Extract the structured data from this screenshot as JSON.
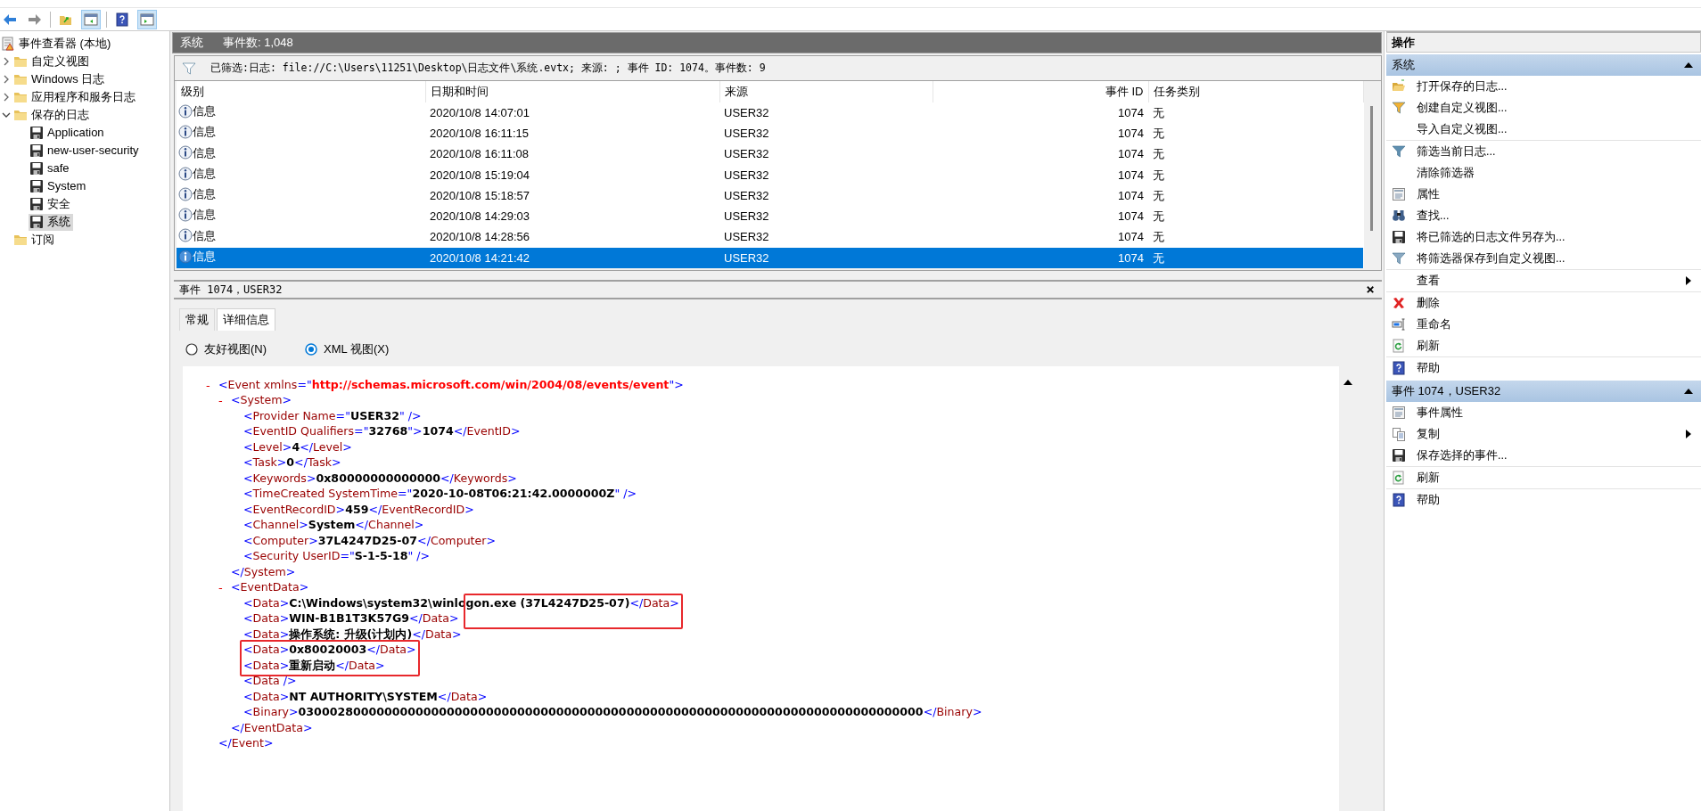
{
  "toolbar": [
    {
      "kind": "back",
      "pressed": false
    },
    {
      "kind": "forward",
      "pressed": false
    },
    {
      "kind": "up",
      "pressed": false
    },
    {
      "kind": "tree-pane",
      "pressed": true
    },
    {
      "kind": "help",
      "pressed": false
    },
    {
      "kind": "action-pane",
      "pressed": true
    }
  ],
  "tree": [
    {
      "label": "事件查看器 (本地)",
      "kind": "root",
      "selected": false,
      "children": [
        {
          "label": "自定义视图",
          "kind": "folder",
          "expanded": false,
          "selected": false
        },
        {
          "label": "Windows 日志",
          "kind": "folder",
          "expanded": false,
          "selected": false
        },
        {
          "label": "应用程序和服务日志",
          "kind": "folder",
          "expanded": false,
          "selected": false
        },
        {
          "label": "保存的日志",
          "kind": "folder",
          "expanded": true,
          "selected": false,
          "children": [
            {
              "label": "Application",
              "kind": "log",
              "selected": false
            },
            {
              "label": "new-user-security",
              "kind": "log",
              "selected": false
            },
            {
              "label": "safe",
              "kind": "log",
              "selected": false
            },
            {
              "label": "System",
              "kind": "log",
              "selected": false
            },
            {
              "label": "安全",
              "kind": "log",
              "selected": false
            },
            {
              "label": "系统",
              "kind": "log",
              "selected": true
            }
          ]
        },
        {
          "label": "订阅",
          "kind": "folder",
          "selected": false
        }
      ]
    }
  ],
  "log_header": {
    "title": "系统",
    "count": "事件数: 1,048"
  },
  "filter": {
    "text": "已筛选:日志: file://C:\\Users\\11251\\Desktop\\日志文件\\系统.evtx; 来源: ; 事件 ID: 1074。事件数: 9"
  },
  "table": {
    "columns": [
      {
        "label": "级别",
        "kind": "level"
      },
      {
        "label": "日期和时间",
        "kind": "text"
      },
      {
        "label": "来源",
        "kind": "text"
      },
      {
        "label": "事件 ID",
        "kind": "number"
      },
      {
        "label": "任务类别",
        "kind": "text"
      }
    ],
    "rows": [
      {
        "cells": [
          "信息",
          "2020/10/8 14:07:01",
          "USER32",
          "1074",
          "无"
        ],
        "selected": false
      },
      {
        "cells": [
          "信息",
          "2020/10/8 16:11:15",
          "USER32",
          "1074",
          "无"
        ],
        "selected": false
      },
      {
        "cells": [
          "信息",
          "2020/10/8 16:11:08",
          "USER32",
          "1074",
          "无"
        ],
        "selected": false
      },
      {
        "cells": [
          "信息",
          "2020/10/8 15:19:04",
          "USER32",
          "1074",
          "无"
        ],
        "selected": false
      },
      {
        "cells": [
          "信息",
          "2020/10/8 15:18:57",
          "USER32",
          "1074",
          "无"
        ],
        "selected": false
      },
      {
        "cells": [
          "信息",
          "2020/10/8 14:29:03",
          "USER32",
          "1074",
          "无"
        ],
        "selected": false
      },
      {
        "cells": [
          "信息",
          "2020/10/8 14:28:56",
          "USER32",
          "1074",
          "无"
        ],
        "selected": false
      },
      {
        "cells": [
          "信息",
          "2020/10/8 14:21:42",
          "USER32",
          "1074",
          "无"
        ],
        "selected": true
      }
    ]
  },
  "detail": {
    "title": "事件 1074，USER32",
    "close": "×",
    "tabs": [
      {
        "label": "常规",
        "selected": false
      },
      {
        "label": "详细信息",
        "selected": true
      }
    ],
    "views": [
      {
        "label": "友好视图(N)",
        "selected": false
      },
      {
        "label": "XML 视图(X)",
        "selected": true
      }
    ],
    "xml": [
      {
        "toggle": "-",
        "segments": [
          {
            "kind": "punct",
            "text": "<"
          },
          {
            "kind": "name",
            "text": "Event xmlns"
          },
          {
            "kind": "punct",
            "text": "=\""
          },
          {
            "kind": "namespace",
            "text": "http://schemas.microsoft.com/win/2004/08/events/event"
          },
          {
            "kind": "punct",
            "text": "\">"
          }
        ],
        "children": [
          {
            "toggle": "-",
            "segments": [
              {
                "kind": "punct",
                "text": "<"
              },
              {
                "kind": "name",
                "text": "System"
              },
              {
                "kind": "punct",
                "text": ">"
              }
            ],
            "children": [
              {
                "segments": [
                  {
                    "kind": "punct",
                    "text": "<"
                  },
                  {
                    "kind": "name",
                    "text": "Provider Name"
                  },
                  {
                    "kind": "punct",
                    "text": "=\""
                  },
                  {
                    "kind": "value",
                    "text": "USER32"
                  },
                  {
                    "kind": "punct",
                    "text": "\" />"
                  }
                ]
              },
              {
                "segments": [
                  {
                    "kind": "punct",
                    "text": "<"
                  },
                  {
                    "kind": "name",
                    "text": "EventID Qualifiers"
                  },
                  {
                    "kind": "punct",
                    "text": "=\""
                  },
                  {
                    "kind": "value",
                    "text": "32768"
                  },
                  {
                    "kind": "punct",
                    "text": "\">"
                  },
                  {
                    "kind": "value",
                    "text": "1074"
                  },
                  {
                    "kind": "punct",
                    "text": "</"
                  },
                  {
                    "kind": "name",
                    "text": "EventID"
                  },
                  {
                    "kind": "punct",
                    "text": ">"
                  }
                ]
              },
              {
                "segments": [
                  {
                    "kind": "punct",
                    "text": "<"
                  },
                  {
                    "kind": "name",
                    "text": "Level"
                  },
                  {
                    "kind": "punct",
                    "text": ">"
                  },
                  {
                    "kind": "value",
                    "text": "4"
                  },
                  {
                    "kind": "punct",
                    "text": "</"
                  },
                  {
                    "kind": "name",
                    "text": "Level"
                  },
                  {
                    "kind": "punct",
                    "text": ">"
                  }
                ]
              },
              {
                "segments": [
                  {
                    "kind": "punct",
                    "text": "<"
                  },
                  {
                    "kind": "name",
                    "text": "Task"
                  },
                  {
                    "kind": "punct",
                    "text": ">"
                  },
                  {
                    "kind": "value",
                    "text": "0"
                  },
                  {
                    "kind": "punct",
                    "text": "</"
                  },
                  {
                    "kind": "name",
                    "text": "Task"
                  },
                  {
                    "kind": "punct",
                    "text": ">"
                  }
                ]
              },
              {
                "segments": [
                  {
                    "kind": "punct",
                    "text": "<"
                  },
                  {
                    "kind": "name",
                    "text": "Keywords"
                  },
                  {
                    "kind": "punct",
                    "text": ">"
                  },
                  {
                    "kind": "value",
                    "text": "0x80000000000000"
                  },
                  {
                    "kind": "punct",
                    "text": "</"
                  },
                  {
                    "kind": "name",
                    "text": "Keywords"
                  },
                  {
                    "kind": "punct",
                    "text": ">"
                  }
                ]
              },
              {
                "segments": [
                  {
                    "kind": "punct",
                    "text": "<"
                  },
                  {
                    "kind": "name",
                    "text": "TimeCreated SystemTime"
                  },
                  {
                    "kind": "punct",
                    "text": "=\""
                  },
                  {
                    "kind": "value",
                    "text": "2020-10-08T06:21:42.0000000Z"
                  },
                  {
                    "kind": "punct",
                    "text": "\" />"
                  }
                ]
              },
              {
                "segments": [
                  {
                    "kind": "punct",
                    "text": "<"
                  },
                  {
                    "kind": "name",
                    "text": "EventRecordID"
                  },
                  {
                    "kind": "punct",
                    "text": ">"
                  },
                  {
                    "kind": "value",
                    "text": "459"
                  },
                  {
                    "kind": "punct",
                    "text": "</"
                  },
                  {
                    "kind": "name",
                    "text": "EventRecordID"
                  },
                  {
                    "kind": "punct",
                    "text": ">"
                  }
                ]
              },
              {
                "segments": [
                  {
                    "kind": "punct",
                    "text": "<"
                  },
                  {
                    "kind": "name",
                    "text": "Channel"
                  },
                  {
                    "kind": "punct",
                    "text": ">"
                  },
                  {
                    "kind": "value",
                    "text": "System"
                  },
                  {
                    "kind": "punct",
                    "text": "</"
                  },
                  {
                    "kind": "name",
                    "text": "Channel"
                  },
                  {
                    "kind": "punct",
                    "text": ">"
                  }
                ]
              },
              {
                "segments": [
                  {
                    "kind": "punct",
                    "text": "<"
                  },
                  {
                    "kind": "name",
                    "text": "Computer"
                  },
                  {
                    "kind": "punct",
                    "text": ">"
                  },
                  {
                    "kind": "value",
                    "text": "37L4247D25-07"
                  },
                  {
                    "kind": "punct",
                    "text": "</"
                  },
                  {
                    "kind": "name",
                    "text": "Computer"
                  },
                  {
                    "kind": "punct",
                    "text": ">"
                  }
                ]
              },
              {
                "segments": [
                  {
                    "kind": "punct",
                    "text": "<"
                  },
                  {
                    "kind": "name",
                    "text": "Security UserID"
                  },
                  {
                    "kind": "punct",
                    "text": "=\""
                  },
                  {
                    "kind": "value",
                    "text": "S-1-5-18"
                  },
                  {
                    "kind": "punct",
                    "text": "\" />"
                  }
                ]
              }
            ],
            "closing": [
              {
                "kind": "punct",
                "text": "</"
              },
              {
                "kind": "name",
                "text": "System"
              },
              {
                "kind": "punct",
                "text": ">"
              }
            ]
          },
          {
            "toggle": "-",
            "segments": [
              {
                "kind": "punct",
                "text": "<"
              },
              {
                "kind": "name",
                "text": "EventData"
              },
              {
                "kind": "punct",
                "text": ">"
              }
            ],
            "children": [
              {
                "segments": [
                  {
                    "kind": "punct",
                    "text": "<"
                  },
                  {
                    "kind": "name",
                    "text": "Data"
                  },
                  {
                    "kind": "punct",
                    "text": ">"
                  },
                  {
                    "kind": "value",
                    "text": "C:\\Windows\\system32\\winlogon.exe (37L4247D25-07)"
                  },
                  {
                    "kind": "punct",
                    "text": "</"
                  },
                  {
                    "kind": "name",
                    "text": "Data"
                  },
                  {
                    "kind": "punct",
                    "text": ">"
                  }
                ]
              },
              {
                "segments": [
                  {
                    "kind": "punct",
                    "text": "<"
                  },
                  {
                    "kind": "name",
                    "text": "Data"
                  },
                  {
                    "kind": "punct",
                    "text": ">"
                  },
                  {
                    "kind": "value",
                    "text": "WIN-B1B1T3K57G9"
                  },
                  {
                    "kind": "punct",
                    "text": "</"
                  },
                  {
                    "kind": "name",
                    "text": "Data"
                  },
                  {
                    "kind": "punct",
                    "text": ">"
                  }
                ]
              },
              {
                "segments": [
                  {
                    "kind": "punct",
                    "text": "<"
                  },
                  {
                    "kind": "name",
                    "text": "Data"
                  },
                  {
                    "kind": "punct",
                    "text": ">"
                  },
                  {
                    "kind": "value",
                    "text": "操作系统: 升级(计划内)"
                  },
                  {
                    "kind": "punct",
                    "text": "</"
                  },
                  {
                    "kind": "name",
                    "text": "Data"
                  },
                  {
                    "kind": "punct",
                    "text": ">"
                  }
                ]
              },
              {
                "segments": [
                  {
                    "kind": "punct",
                    "text": "<"
                  },
                  {
                    "kind": "name",
                    "text": "Data"
                  },
                  {
                    "kind": "punct",
                    "text": ">"
                  },
                  {
                    "kind": "value",
                    "text": "0x80020003"
                  },
                  {
                    "kind": "punct",
                    "text": "</"
                  },
                  {
                    "kind": "name",
                    "text": "Data"
                  },
                  {
                    "kind": "punct",
                    "text": ">"
                  }
                ]
              },
              {
                "segments": [
                  {
                    "kind": "punct",
                    "text": "<"
                  },
                  {
                    "kind": "name",
                    "text": "Data"
                  },
                  {
                    "kind": "punct",
                    "text": ">"
                  },
                  {
                    "kind": "value",
                    "text": "重新启动"
                  },
                  {
                    "kind": "punct",
                    "text": "</"
                  },
                  {
                    "kind": "name",
                    "text": "Data"
                  },
                  {
                    "kind": "punct",
                    "text": ">"
                  }
                ]
              },
              {
                "segments": [
                  {
                    "kind": "punct",
                    "text": "<"
                  },
                  {
                    "kind": "name",
                    "text": "Data"
                  },
                  {
                    "kind": "punct",
                    "text": " />"
                  }
                ]
              },
              {
                "segments": [
                  {
                    "kind": "punct",
                    "text": "<"
                  },
                  {
                    "kind": "name",
                    "text": "Data"
                  },
                  {
                    "kind": "punct",
                    "text": ">"
                  },
                  {
                    "kind": "value",
                    "text": "NT AUTHORITY\\SYSTEM"
                  },
                  {
                    "kind": "punct",
                    "text": "</"
                  },
                  {
                    "kind": "name",
                    "text": "Data"
                  },
                  {
                    "kind": "punct",
                    "text": ">"
                  }
                ]
              },
              {
                "segments": [
                  {
                    "kind": "punct",
                    "text": "<"
                  },
                  {
                    "kind": "name",
                    "text": "Binary"
                  },
                  {
                    "kind": "punct",
                    "text": ">"
                  },
                  {
                    "kind": "value",
                    "text": "03000280000000000000000000000000000000000000000000000000000000000000000000000000"
                  },
                  {
                    "kind": "punct",
                    "text": "</"
                  },
                  {
                    "kind": "name",
                    "text": "Binary"
                  },
                  {
                    "kind": "punct",
                    "text": ">"
                  }
                ]
              }
            ],
            "closing": [
              {
                "kind": "punct",
                "text": "</"
              },
              {
                "kind": "name",
                "text": "EventData"
              },
              {
                "kind": "punct",
                "text": ">"
              }
            ]
          }
        ],
        "closing": [
          {
            "kind": "punct",
            "text": "</"
          },
          {
            "kind": "name",
            "text": "Event"
          },
          {
            "kind": "punct",
            "text": ">"
          }
        ]
      }
    ],
    "annotations": [
      {
        "kind": "rectangle"
      },
      {
        "kind": "rectangle"
      }
    ]
  },
  "actions": {
    "title": "操作",
    "sections": [
      {
        "title": "系统",
        "expanded": true,
        "groups": [
          [
            {
              "label": "打开保存的日志...",
              "kind": "open",
              "submenu": false
            },
            {
              "label": "创建自定义视图...",
              "kind": "filter-new",
              "submenu": false
            },
            {
              "label": "导入自定义视图...",
              "kind": "plain",
              "submenu": false
            }
          ],
          [
            {
              "label": "筛选当前日志...",
              "kind": "filter",
              "submenu": false
            },
            {
              "label": "清除筛选器",
              "kind": "plain",
              "submenu": false
            },
            {
              "label": "属性",
              "kind": "properties",
              "submenu": false
            },
            {
              "label": "查找...",
              "kind": "find",
              "submenu": false
            },
            {
              "label": "将已筛选的日志文件另存为...",
              "kind": "save",
              "submenu": false
            },
            {
              "label": "将筛选器保存到自定义视图...",
              "kind": "filter-save",
              "submenu": false
            }
          ],
          [
            {
              "label": "查看",
              "kind": "plain",
              "submenu": true
            }
          ],
          [
            {
              "label": "删除",
              "kind": "delete",
              "submenu": false
            },
            {
              "label": "重命名",
              "kind": "rename",
              "submenu": false
            },
            {
              "label": "刷新",
              "kind": "refresh",
              "submenu": false
            }
          ],
          [
            {
              "label": "帮助",
              "kind": "help",
              "submenu": false
            }
          ]
        ]
      },
      {
        "title": "事件 1074，USER32",
        "expanded": true,
        "groups": [
          [
            {
              "label": "事件属性",
              "kind": "properties",
              "submenu": false
            },
            {
              "label": "复制",
              "kind": "copy",
              "submenu": true
            },
            {
              "label": "保存选择的事件...",
              "kind": "save",
              "submenu": false
            }
          ],
          [
            {
              "label": "刷新",
              "kind": "refresh",
              "submenu": false
            }
          ],
          [
            {
              "label": "帮助",
              "kind": "help",
              "submenu": false
            }
          ]
        ]
      }
    ]
  }
}
